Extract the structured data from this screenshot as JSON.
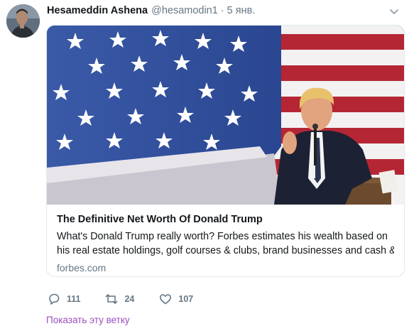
{
  "tweet": {
    "author_name": "Hesameddin Ashena",
    "author_handle": "@hesamodin1",
    "separator": "·",
    "time": "5 янв.",
    "card": {
      "title": "The Definitive Net Worth Of Donald Trump",
      "description_line1": "What's Donald Trump really worth? Forbes estimates his wealth based on",
      "description_line2": "his real estate holdings, golf courses & clubs, brand businesses and cash &",
      "domain": "forbes.com"
    },
    "actions": {
      "reply_count": "111",
      "retweet_count": "24",
      "like_count": "107"
    },
    "thread_link": "Показать эту ветку"
  },
  "colors": {
    "text_primary": "#14171a",
    "text_secondary": "#657786",
    "border": "#e1e8ed",
    "link": "#9a4fbf"
  },
  "icons": [
    "avatar",
    "chevron-down-icon",
    "reply-icon",
    "retweet-icon",
    "like-icon"
  ]
}
